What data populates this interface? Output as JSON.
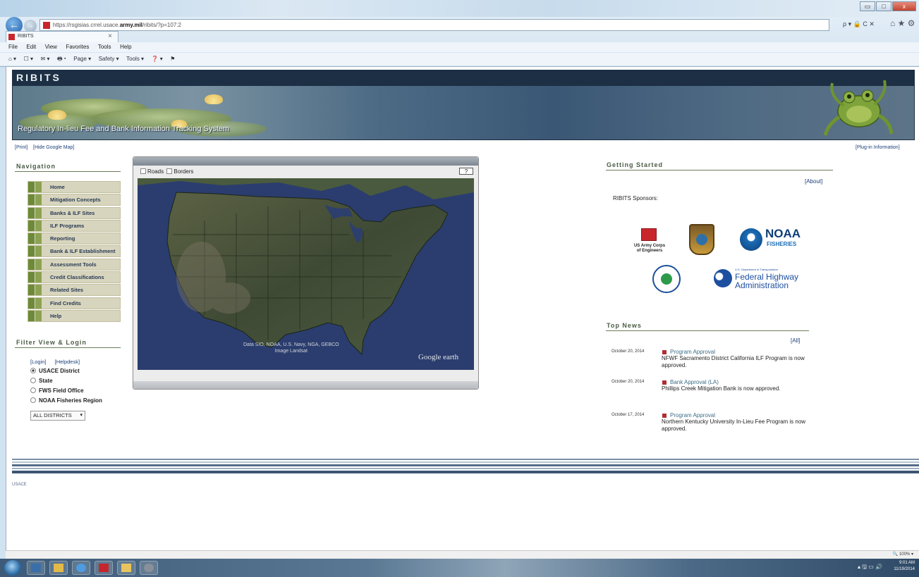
{
  "browser": {
    "url_prefix": "https://",
    "url_mid": "rsgisias.crrel.usace.",
    "url_domain": "army.mil",
    "url_suffix": "/ribits/?p=107:2",
    "tab_label": "RIBITS",
    "tab_close": "×",
    "addr_tools": "ρ ▾ 🔒 C ✕",
    "home_icons": "⌂ ★ ⚙",
    "menu": [
      "File",
      "Edit",
      "View",
      "Favorites",
      "Tools",
      "Help"
    ],
    "commands": [
      "⌂ ▾",
      "☐ ▾",
      "✉ ▾",
      "🖶 ▾",
      "Page ▾",
      "Safety ▾",
      "Tools ▾",
      "❓ ▾",
      "⚑"
    ],
    "back_icon": "←",
    "forward_icon": "→",
    "window_buttons": [
      "▭",
      "□",
      "x"
    ],
    "zoom": "🔍 100% ▾"
  },
  "banner": {
    "title": "RIBITS",
    "subtitle": "Regulatory In-lieu Fee and Bank Information Tracking System"
  },
  "links": {
    "print": "[Print]",
    "hide_map": "[Hide Google Map]",
    "plugin": "[Plug-in Information]",
    "about": "[About]",
    "all": "[All]",
    "login": "[Login]",
    "helpdesk": "[Helpdesk]"
  },
  "navigation": {
    "heading": "Navigation",
    "items": [
      "Home",
      "Mitigation Concepts",
      "Banks & ILF Sites",
      "ILF Programs",
      "Reporting",
      "Bank & ILF Establishment",
      "Assessment Tools",
      "Credit Classifications",
      "Related Sites",
      "Find Credits",
      "Help"
    ]
  },
  "filter": {
    "heading": "Filter View & Login",
    "options": [
      "USACE District",
      "State",
      "FWS Field Office",
      "NOAA Fisheries Region"
    ],
    "selected_option": "USACE District",
    "district_value": "ALL DISTRICTS",
    "select_arrow": "▾"
  },
  "map": {
    "roads_label": "Roads",
    "borders_label": "Borders",
    "help_glyph": "?",
    "attribution_line1": "Data SIO, NOAA, U.S. Navy, NGA, GEBCO",
    "attribution_line2": "Image Landsat",
    "logo": "Google earth"
  },
  "getting_started": {
    "heading": "Getting Started",
    "sponsors_label": "RIBITS Sponsors:",
    "sponsor_logos": [
      {
        "name": "US Army Corps of Engineers",
        "line1": "US Army Corps",
        "line2": "of Engineers"
      },
      {
        "name": "U.S. Fish & Wildlife Service"
      },
      {
        "name": "NOAA Fisheries",
        "line1": "NOAA",
        "line2": "FISHERIES"
      },
      {
        "name": "EPA"
      },
      {
        "name": "Federal Highway Administration",
        "line0": "U.S. Department of Transportation",
        "line1": "Federal Highway",
        "line2": "Administration"
      }
    ]
  },
  "top_news": {
    "heading": "Top News",
    "items": [
      {
        "date": "October 20, 2014",
        "title": "Program Approval",
        "body": "NFWF Sacramento District California ILF Program is now approved."
      },
      {
        "date": "October 20, 2014",
        "title": "Bank Approval (LA)",
        "body": "Phillips Creek Mitigation Bank is now approved."
      },
      {
        "date": "October 17, 2014",
        "title": "Program Approval",
        "body": "Northern Kentucky University In-Lieu Fee Program is now approved."
      }
    ]
  },
  "footer": {
    "org": "USACE"
  },
  "taskbar": {
    "time": "9:01 AM",
    "date": "11/19/2014",
    "tray_icons": "▴ 🖫 ▭ 🔊"
  },
  "colors": {
    "nav_bg": "#d7d5bd",
    "nav_accent": "#6c8a38",
    "link": "#1c3f7a",
    "news_title": "#3d6e86",
    "news_bullet": "#b12c33",
    "banner": "#2a3f56"
  }
}
